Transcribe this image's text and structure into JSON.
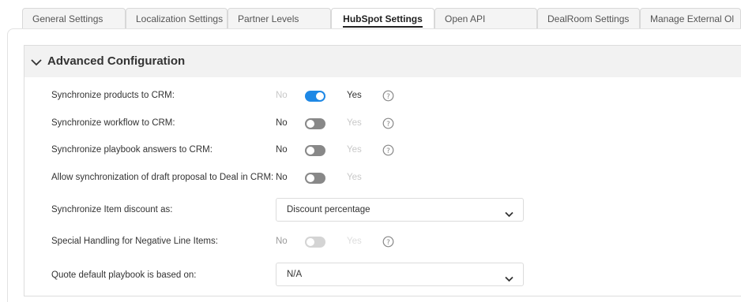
{
  "tabs": [
    {
      "label": "General Settings",
      "active": false
    },
    {
      "label": "Localization Settings",
      "active": false
    },
    {
      "label": "Partner Levels",
      "active": false
    },
    {
      "label": "HubSpot Settings",
      "active": true
    },
    {
      "label": "Open API",
      "active": false
    },
    {
      "label": "DealRoom Settings",
      "active": false
    },
    {
      "label": "Manage External Ol",
      "active": false
    }
  ],
  "section": {
    "title": "Advanced Configuration",
    "expanded": true,
    "icon": "chevron-down-icon"
  },
  "settings": [
    {
      "label": "Synchronize products to CRM:",
      "type": "toggle",
      "value": "Yes",
      "no": "No",
      "yes": "Yes",
      "help": true
    },
    {
      "label": "Synchronize workflow to CRM:",
      "type": "toggle",
      "value": "No",
      "no": "No",
      "yes": "Yes",
      "help": true
    },
    {
      "label": "Synchronize playbook answers to CRM:",
      "type": "toggle",
      "value": "No",
      "no": "No",
      "yes": "Yes",
      "help": true
    },
    {
      "label": "Allow synchronization of draft proposal to Deal in CRM:",
      "type": "toggle",
      "value": "No",
      "no": "No",
      "yes": "Yes",
      "help": false
    },
    {
      "label": "Synchronize Item discount as:",
      "type": "select",
      "value": "Discount percentage"
    },
    {
      "label": "Special Handling for Negative Line Items:",
      "type": "toggle",
      "value": "No",
      "disabled": true,
      "no": "No",
      "yes": "Yes",
      "help": true
    },
    {
      "label": "Quote default playbook is based on:",
      "type": "select",
      "value": "N/A"
    }
  ],
  "colors": {
    "accent": "#1e88e5",
    "toggle_off": "#888888",
    "toggle_disabled": "#d4d4d4",
    "header_bg": "#f2f2f2"
  }
}
